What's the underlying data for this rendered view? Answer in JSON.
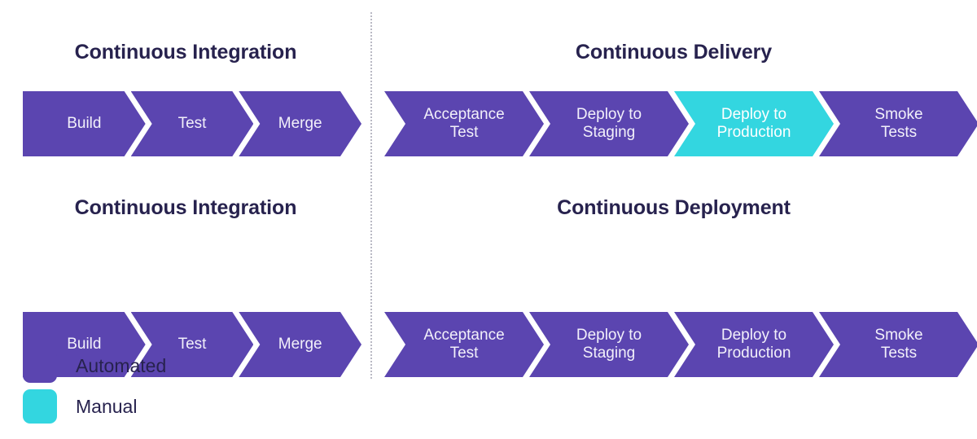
{
  "colors": {
    "automated": "#5B45B0",
    "manual": "#33D6E0",
    "title_text": "#27224E",
    "chevron_text": "#F2F0FA",
    "background": "#FFFFFF",
    "divider": "#B9B9C4"
  },
  "panels": {
    "left": {
      "sections": [
        {
          "title": "Continuous Integration",
          "stages": [
            {
              "label": "Build",
              "type": "automated"
            },
            {
              "label": "Test",
              "type": "automated"
            },
            {
              "label": "Merge",
              "type": "automated"
            }
          ]
        },
        {
          "title": "Continuous Integration",
          "stages": [
            {
              "label": "Build",
              "type": "automated"
            },
            {
              "label": "Test",
              "type": "automated"
            },
            {
              "label": "Merge",
              "type": "automated"
            }
          ]
        }
      ]
    },
    "right": {
      "sections": [
        {
          "title": "Continuous Delivery",
          "stages": [
            {
              "label": "Acceptance\nTest",
              "type": "automated"
            },
            {
              "label": "Deploy to\nStaging",
              "type": "automated"
            },
            {
              "label": "Deploy to\nProduction",
              "type": "manual"
            },
            {
              "label": "Smoke\nTests",
              "type": "automated"
            }
          ]
        },
        {
          "title": "Continuous Deployment",
          "stages": [
            {
              "label": "Acceptance\nTest",
              "type": "automated"
            },
            {
              "label": "Deploy to\nStaging",
              "type": "automated"
            },
            {
              "label": "Deploy to\nProduction",
              "type": "automated"
            },
            {
              "label": "Smoke\nTests",
              "type": "automated"
            }
          ]
        }
      ]
    }
  },
  "legend": {
    "items": [
      {
        "label": "Automated",
        "type": "automated"
      },
      {
        "label": "Manual",
        "type": "manual"
      }
    ]
  }
}
